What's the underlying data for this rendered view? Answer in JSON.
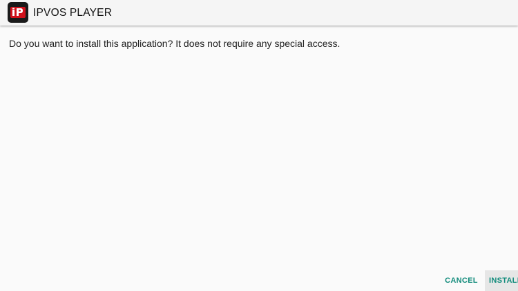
{
  "app": {
    "name": "IPVOS PLAYER",
    "icon": "ipvos-player-logo-icon",
    "icon_letters": "iP",
    "colors": {
      "icon_bg": "#1a1a1a",
      "icon_accent": "#d0111b",
      "button_text": "#0f8a7a"
    }
  },
  "dialog": {
    "message": "Do you want to install this application? It does not require any special access."
  },
  "actions": {
    "cancel_label": "CANCEL",
    "install_label": "INSTALL"
  }
}
